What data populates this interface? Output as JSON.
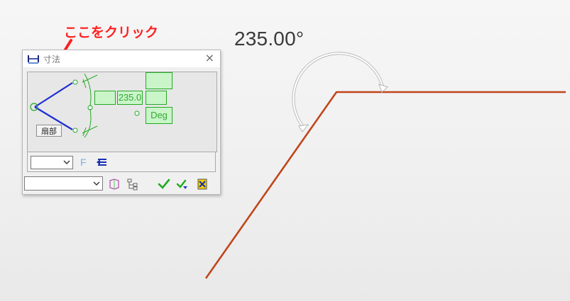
{
  "canvas": {
    "angle_text": "235.00°",
    "line_color": "#c0461b"
  },
  "callout": {
    "text": "ここをクリック",
    "color": "#ff2020"
  },
  "dialog": {
    "title": "寸法",
    "close_symbol": "×",
    "preview": {
      "value_text": "235.0",
      "unit_text": "Deg",
      "tooltip": "扇部"
    },
    "dropdown_1": {
      "value": ""
    },
    "dropdown_2": {
      "value": ""
    },
    "toolbar_icons": [
      "format-f-icon",
      "arrows-icon",
      "part-icon",
      "tree-icon",
      "check-icon",
      "check-apply-icon",
      "exit-icon"
    ]
  }
}
